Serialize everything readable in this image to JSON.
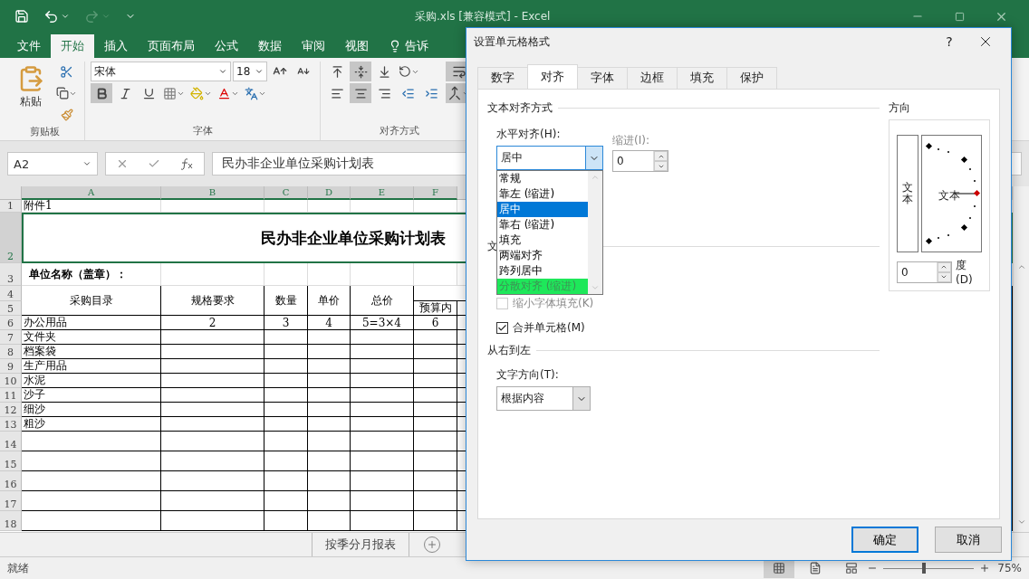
{
  "title_bar": {
    "title": "采购.xls  [兼容模式] - Excel"
  },
  "ribbon": {
    "tabs": [
      {
        "label": "文件",
        "selected": false
      },
      {
        "label": "开始",
        "selected": true
      },
      {
        "label": "插入",
        "selected": false
      },
      {
        "label": "页面布局",
        "selected": false
      },
      {
        "label": "公式",
        "selected": false
      },
      {
        "label": "数据",
        "selected": false
      },
      {
        "label": "审阅",
        "selected": false
      },
      {
        "label": "视图",
        "selected": false
      },
      {
        "label": "告诉",
        "selected": false
      }
    ],
    "paste_label": "粘贴",
    "font_name": "宋体",
    "font_size": "18",
    "font_toggles": [
      {
        "kind": "bold",
        "on": true
      },
      {
        "kind": "italic",
        "on": false
      },
      {
        "kind": "underline",
        "on": false
      }
    ],
    "vertical_align": [
      {
        "kind": "top",
        "selected": false
      },
      {
        "kind": "middle",
        "selected": true
      },
      {
        "kind": "bottom",
        "selected": false
      }
    ],
    "horizontal_align": [
      {
        "kind": "left",
        "selected": false
      },
      {
        "kind": "center",
        "selected": true
      },
      {
        "kind": "right",
        "selected": false
      }
    ],
    "wrap_on": true,
    "merge_on": true,
    "groups": [
      "剪贴板",
      "字体",
      "对齐方式"
    ]
  },
  "formula_bar": {
    "name_box": "A2",
    "formula": "民办非企业单位采购计划表"
  },
  "sheet": {
    "columns": [
      {
        "label": "A",
        "selected": true
      },
      {
        "label": "B",
        "selected": true
      },
      {
        "label": "C",
        "selected": true
      },
      {
        "label": "D",
        "selected": true
      },
      {
        "label": "E",
        "selected": true
      },
      {
        "label": "F",
        "selected": true
      }
    ],
    "row_numbers": [
      {
        "label": "1",
        "selected": false
      },
      {
        "label": "2",
        "selected": true
      },
      {
        "label": "3",
        "selected": false
      },
      {
        "label": "4",
        "selected": false
      },
      {
        "label": "5",
        "selected": false
      },
      {
        "label": "6",
        "selected": false
      },
      {
        "label": "7",
        "selected": false
      },
      {
        "label": "8",
        "selected": false
      },
      {
        "label": "9",
        "selected": false
      },
      {
        "label": "10",
        "selected": false
      },
      {
        "label": "11",
        "selected": false
      },
      {
        "label": "12",
        "selected": false
      },
      {
        "label": "13",
        "selected": false
      },
      {
        "label": "14",
        "selected": false
      },
      {
        "label": "15",
        "selected": false
      },
      {
        "label": "16",
        "selected": false
      },
      {
        "label": "17",
        "selected": false
      },
      {
        "label": "18",
        "selected": false
      }
    ],
    "blocks": [
      {
        "kind": "note",
        "text": "附件1"
      },
      {
        "kind": "title",
        "text": "民办非企业单位采购计划表",
        "selected": true
      },
      {
        "kind": "label",
        "text": "单位名称（盖章）："
      },
      {
        "kind": "header",
        "cells": [
          "采购目录",
          "规格要求",
          "数量",
          "单价",
          "总价"
        ],
        "sub": "预算内"
      },
      {
        "kind": "data",
        "cells": [
          "办公用品",
          "2",
          "3",
          "4",
          "5=3×4",
          "6"
        ]
      },
      {
        "kind": "data",
        "cells": [
          "文件夹"
        ]
      },
      {
        "kind": "data",
        "cells": [
          "档案袋"
        ]
      },
      {
        "kind": "data",
        "cells": [
          "生产用品"
        ]
      },
      {
        "kind": "data",
        "cells": [
          "水泥"
        ]
      },
      {
        "kind": "data",
        "cells": [
          "沙子"
        ]
      },
      {
        "kind": "data",
        "cells": [
          "细沙"
        ]
      },
      {
        "kind": "data",
        "cells": [
          "粗沙"
        ]
      },
      {
        "kind": "blank"
      },
      {
        "kind": "blank"
      },
      {
        "kind": "blank"
      },
      {
        "kind": "blank"
      },
      {
        "kind": "blank"
      }
    ]
  },
  "sheet_tabs": [
    {
      "label": "按季分月报表",
      "selected": false
    }
  ],
  "status_bar": {
    "text": "就绪",
    "zoom_slider": {
      "level": 0.45
    },
    "zoom": "75%"
  },
  "dialog": {
    "title": "设置单元格格式",
    "help": "?",
    "tabs": [
      {
        "label": "数字",
        "selected": false
      },
      {
        "label": "对齐",
        "selected": true
      },
      {
        "label": "字体",
        "selected": false
      },
      {
        "label": "边框",
        "selected": false
      },
      {
        "label": "填充",
        "selected": false
      },
      {
        "label": "保护",
        "selected": false
      }
    ],
    "alignment": {
      "heading": "文本对齐方式",
      "horizontal_label": "水平对齐(H):",
      "horizontal_value": "居中",
      "options": [
        {
          "label": "常规",
          "selected": false,
          "highlighted": false
        },
        {
          "label": "靠左 (缩进)",
          "selected": false,
          "highlighted": false
        },
        {
          "label": "居中",
          "selected": true,
          "highlighted": false
        },
        {
          "label": "靠右 (缩进)",
          "selected": false,
          "highlighted": false
        },
        {
          "label": "填充",
          "selected": false,
          "highlighted": false
        },
        {
          "label": "两端对齐",
          "selected": false,
          "highlighted": false
        },
        {
          "label": "跨列居中",
          "selected": false,
          "highlighted": false
        },
        {
          "label": "分散对齐 (缩进)",
          "selected": false,
          "highlighted": true
        }
      ],
      "indent_label": "缩进(I):",
      "indent_value": "0",
      "indent_disabled": true
    },
    "control": {
      "heading": "文",
      "checks": [
        {
          "label": "缩小字体填充(K)",
          "checked": false,
          "disabled": true
        },
        {
          "label": "合并单元格(M)",
          "checked": true,
          "disabled": false
        }
      ]
    },
    "rtl": {
      "heading": "从右到左",
      "direction_label": "文字方向(T):",
      "direction_value": "根据内容"
    },
    "orientation": {
      "heading": "方向",
      "vertical_text": "文本",
      "dial_text": "文本",
      "degrees_value": "0",
      "degrees_label": "度(D)"
    },
    "buttons": [
      {
        "label": "确定",
        "default": true
      },
      {
        "label": "取消",
        "default": false
      }
    ]
  }
}
